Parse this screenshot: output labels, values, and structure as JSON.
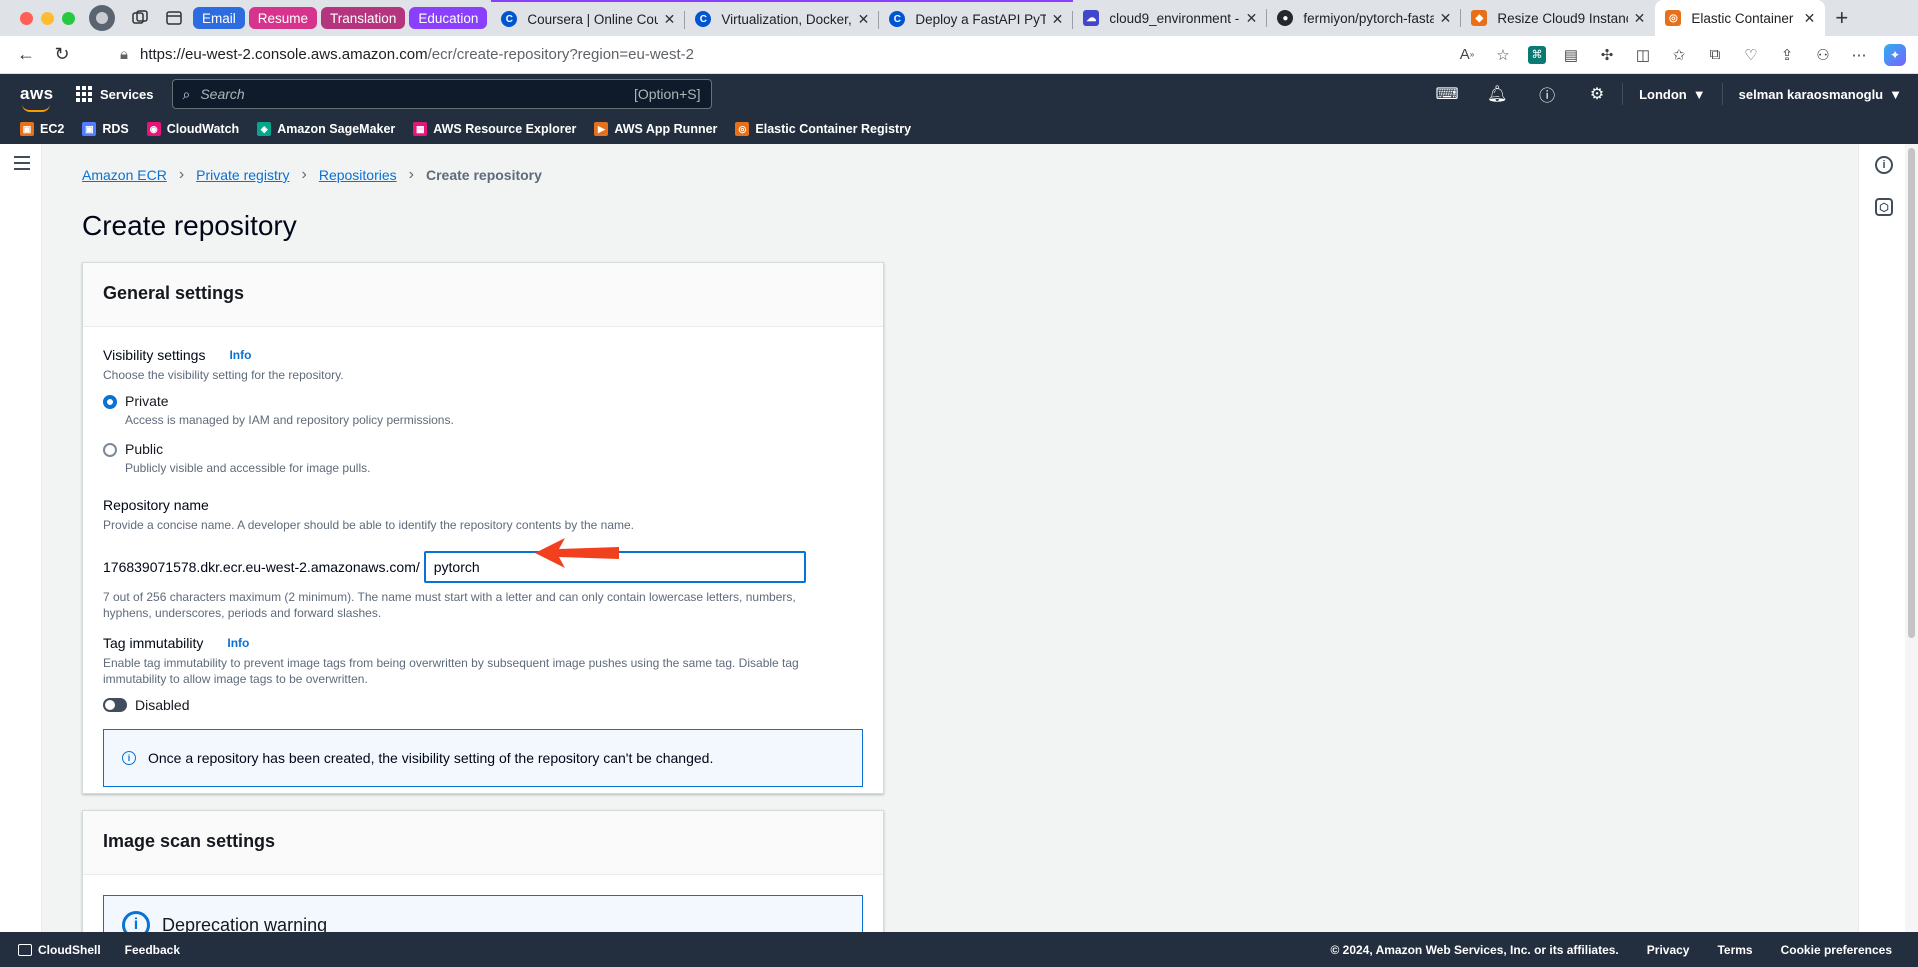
{
  "browser": {
    "tab_groups": [
      {
        "label": "Email",
        "color": "#2d6cdf"
      },
      {
        "label": "Resume",
        "color": "#d6338c"
      },
      {
        "label": "Translation",
        "color": "#b4357e"
      },
      {
        "label": "Education",
        "color": "#8a3ffc"
      }
    ],
    "tabs": [
      {
        "title": "Coursera | Online Cour",
        "favicon": "coursera-icon",
        "favcolor": "#0056d2"
      },
      {
        "title": "Virtualization, Docker,",
        "favicon": "coursera-icon",
        "favcolor": "#0056d2"
      },
      {
        "title": "Deploy a FastAPI PyTor",
        "favicon": "coursera-icon",
        "favcolor": "#0056d2"
      },
      {
        "title": "cloud9_environment -",
        "favicon": "cloud9-icon",
        "favcolor": "#3f48cc"
      },
      {
        "title": "fermiyon/pytorch-fasta",
        "favicon": "github-icon",
        "favcolor": "#24292f"
      },
      {
        "title": "Resize Cloud9 Instanc",
        "favicon": "aws-icon",
        "favcolor": "#e7711b"
      },
      {
        "title": "Elastic Container Regi",
        "favicon": "ecr-icon",
        "favcolor": "#e7711b",
        "active": true
      }
    ],
    "url_host": "https://eu-west-2.console.aws.amazon.com",
    "url_path": "/ecr/create-repository?region=eu-west-2"
  },
  "aws": {
    "services_label": "Services",
    "search_placeholder": "Search",
    "search_shortcut": "[Option+S]",
    "region": "London",
    "user": "selman karaosmanoglu",
    "favorites": [
      {
        "label": "EC2",
        "color": "#e7711b"
      },
      {
        "label": "RDS",
        "color": "#527fff"
      },
      {
        "label": "CloudWatch",
        "color": "#e7157b"
      },
      {
        "label": "Amazon SageMaker",
        "color": "#01a88d"
      },
      {
        "label": "AWS Resource Explorer",
        "color": "#e7157b"
      },
      {
        "label": "AWS App Runner",
        "color": "#e7711b"
      },
      {
        "label": "Elastic Container Registry",
        "color": "#e7711b"
      }
    ]
  },
  "breadcrumb": {
    "items": [
      "Amazon ECR",
      "Private registry",
      "Repositories"
    ],
    "current": "Create repository"
  },
  "page_title": "Create repository",
  "general": {
    "title": "General settings",
    "visibility_label": "Visibility settings",
    "info": "Info",
    "visibility_desc": "Choose the visibility setting for the repository.",
    "private_label": "Private",
    "private_desc": "Access is managed by IAM and repository policy permissions.",
    "public_label": "Public",
    "public_desc": "Publicly visible and accessible for image pulls.",
    "repo_label": "Repository name",
    "repo_desc": "Provide a concise name. A developer should be able to identify the repository contents by the name.",
    "repo_prefix": "176839071578.dkr.ecr.eu-west-2.amazonaws.com/",
    "repo_value": "pytorch",
    "repo_hint_1": "7 out of 256 characters maximum (2 minimum). The name must start with a letter and can only contain lowercase letters, numbers,",
    "repo_hint_2": "hyphens, underscores, periods and forward slashes.",
    "tag_label": "Tag immutability",
    "tag_desc_1": "Enable tag immutability to prevent image tags from being overwritten by subsequent image pushes using the same tag. Disable tag",
    "tag_desc_2": "immutability to allow image tags to be overwritten.",
    "tag_state": "Disabled",
    "alert": "Once a repository has been created, the visibility setting of the repository can't be changed."
  },
  "scan": {
    "title": "Image scan settings",
    "deprecation": "Deprecation warning"
  },
  "footer": {
    "cloudshell": "CloudShell",
    "feedback": "Feedback",
    "copyright": "© 2024, Amazon Web Services, Inc. or its affiliates.",
    "privacy": "Privacy",
    "terms": "Terms",
    "cookies": "Cookie preferences"
  },
  "colors": {
    "aws_dark": "#232f3e",
    "link_blue": "#0972d3",
    "annotation_red": "#f0401e"
  }
}
